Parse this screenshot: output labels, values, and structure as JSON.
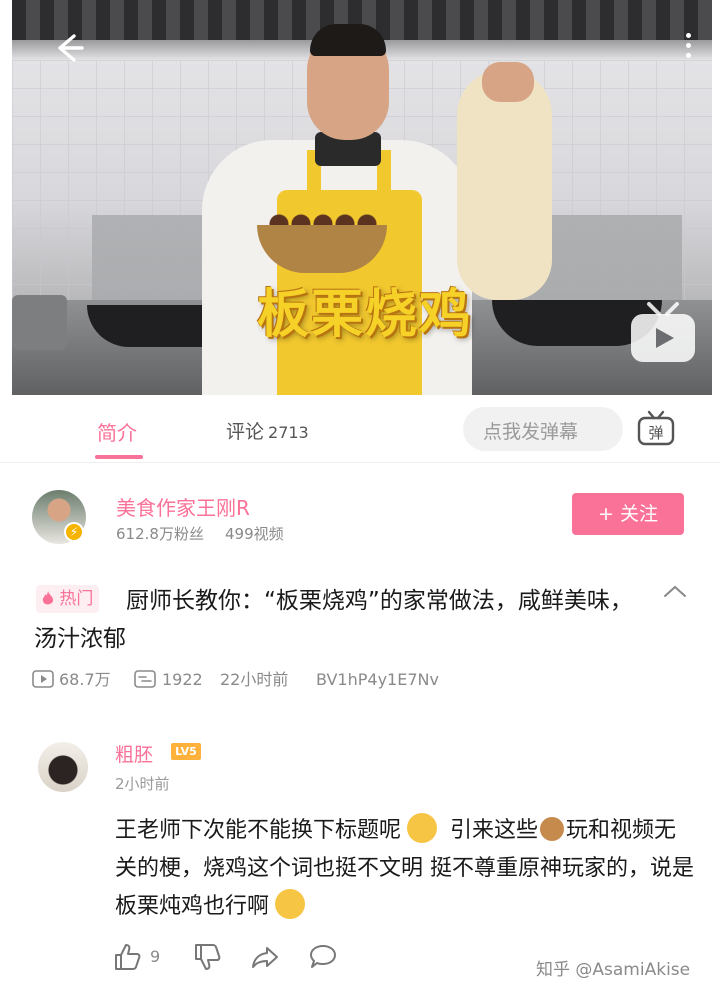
{
  "video": {
    "title_overlay": "板栗烧鸡"
  },
  "tabs": {
    "intro_label": "简介",
    "comments_label": "评论",
    "comments_count": "2713"
  },
  "danmaku": {
    "placeholder": "点我发弹幕",
    "button_label": "弹"
  },
  "uploader": {
    "name": "美食作家王刚R",
    "fans": "612.8万粉丝",
    "videos": "499视频",
    "follow_label": "+ 关注"
  },
  "info": {
    "hot_label": "热门",
    "description": "厨师长教你：“板栗烧鸡”的家常做法，咸鲜美味，汤汁浓郁",
    "views": "68.7万",
    "danmaku_count": "1922",
    "posted": "22小时前",
    "bvid": "BV1hP4y1E7Nv"
  },
  "comment": {
    "user": "粗胚",
    "level": "LV5",
    "time": "2小时前",
    "text_part1": "王老师下次能不能换下标题呢",
    "text_part2": " 引来这些",
    "text_part3": "玩和视频无关的梗，烧鸡这个词也挺不文明 挺不尊重原神玩家的，说是板栗炖鸡也行啊",
    "likes": "9"
  },
  "watermark": "知乎 @AsamiAkise",
  "colors": {
    "accent": "#fb7299",
    "title_overlay": "#f6d128",
    "level_badge": "#ffb23b"
  }
}
